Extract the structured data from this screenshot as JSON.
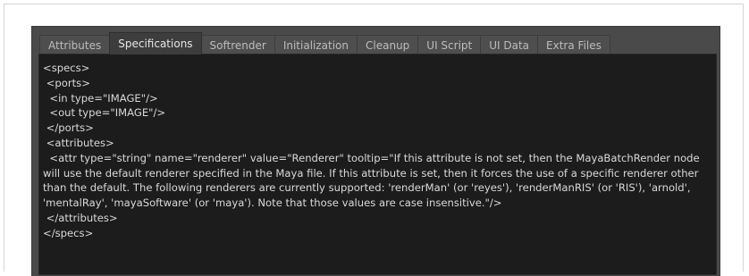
{
  "tabs": [
    {
      "label": "Attributes",
      "active": false
    },
    {
      "label": "Specifications",
      "active": true
    },
    {
      "label": "Softrender",
      "active": false
    },
    {
      "label": "Initialization",
      "active": false
    },
    {
      "label": "Cleanup",
      "active": false
    },
    {
      "label": "UI Script",
      "active": false
    },
    {
      "label": "UI Data",
      "active": false
    },
    {
      "label": "Extra Files",
      "active": false
    }
  ],
  "editor": {
    "content": "<specs>\n <ports>\n  <in type=\"IMAGE\"/>\n  <out type=\"IMAGE\"/>\n </ports>\n <attributes>\n  <attr type=\"string\" name=\"renderer\" value=\"Renderer\" tooltip=\"If this attribute is not set, then the MayaBatchRender node will use the default renderer specified in the Maya file. If this attribute is set, then it forces the use of a specific renderer other than the default. The following renderers are currently supported: 'renderMan' (or 'reyes'), 'renderManRIS' (or 'RIS'), 'arnold', 'mentalRay', 'mayaSoftware' (or 'maya'). Note that those values are case insensitive.\"/>\n </attributes>\n</specs>"
  },
  "colors": {
    "panel_bg": "#4a4a4a",
    "editor_bg": "#1c1c1c",
    "text": "#d9d9d9",
    "tab_active_bg": "#3d3d3d"
  }
}
